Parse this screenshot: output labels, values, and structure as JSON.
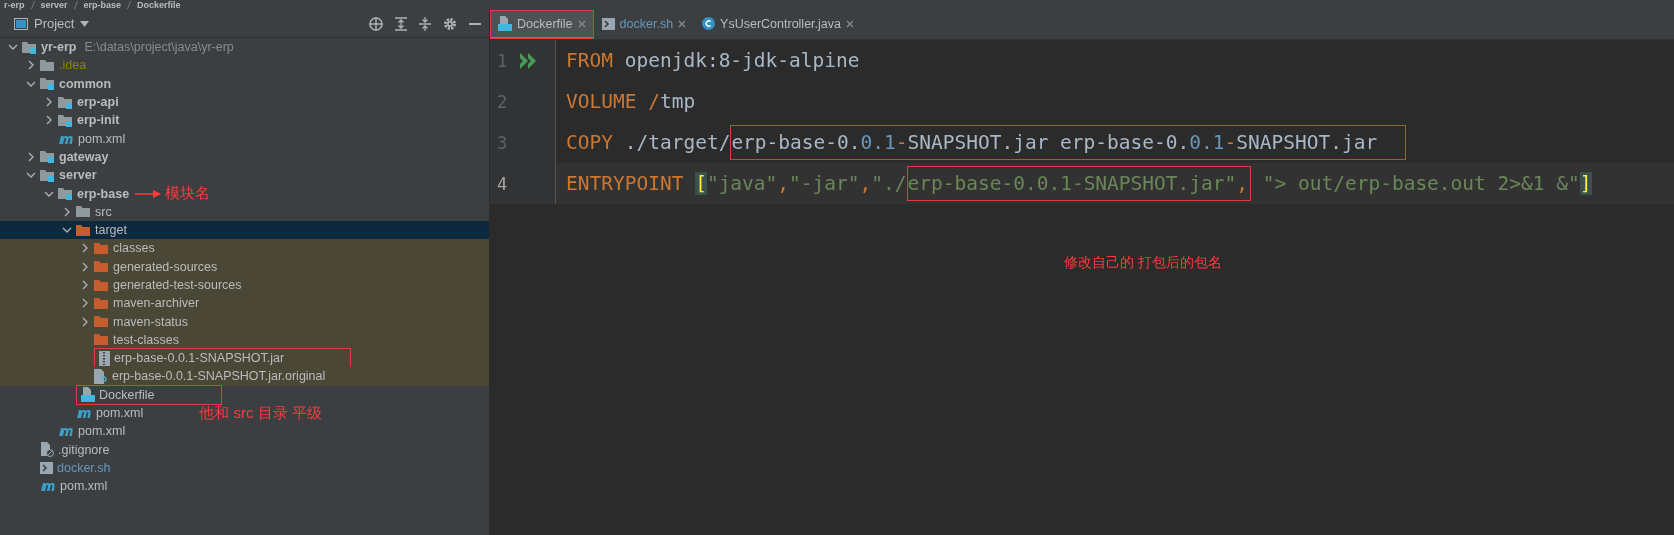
{
  "breadcrumb": [
    "r-erp",
    "server",
    "erp-base",
    "Dockerfile"
  ],
  "project_panel": {
    "title": "Project",
    "tree": [
      {
        "name": "yr-erp",
        "kind": "module",
        "hint": "E:\\datas\\project\\java\\yr-erp",
        "expanded": true,
        "selected": false,
        "children": [
          {
            "name": ".idea",
            "kind": "folder",
            "color": "#848504",
            "expanded": false,
            "selected": false
          },
          {
            "name": "common",
            "kind": "module",
            "expanded": true,
            "selected": false,
            "children": [
              {
                "name": "erp-api",
                "kind": "module",
                "expanded": false,
                "selected": false
              },
              {
                "name": "erp-init",
                "kind": "module",
                "expanded": false,
                "selected": false
              },
              {
                "name": "pom.xml",
                "kind": "maven",
                "selected": false
              }
            ]
          },
          {
            "name": "gateway",
            "kind": "module",
            "expanded": false,
            "selected": false
          },
          {
            "name": "server",
            "kind": "module",
            "expanded": true,
            "selected": false,
            "children": [
              {
                "name": "erp-base",
                "kind": "module",
                "expanded": true,
                "selected": false,
                "note": {
                  "text": "模块名",
                  "arrow": true
                },
                "children": [
                  {
                    "name": "src",
                    "kind": "folder",
                    "expanded": false,
                    "selected": false
                  },
                  {
                    "name": "target",
                    "kind": "excluded-folder",
                    "expanded": true,
                    "selected": true,
                    "children": [
                      {
                        "name": "classes",
                        "kind": "excluded-folder",
                        "expanded": false,
                        "selected": false,
                        "excluded": true
                      },
                      {
                        "name": "generated-sources",
                        "kind": "excluded-folder",
                        "expanded": false,
                        "selected": false,
                        "excluded": true
                      },
                      {
                        "name": "generated-test-sources",
                        "kind": "excluded-folder",
                        "expanded": false,
                        "selected": false,
                        "excluded": true
                      },
                      {
                        "name": "maven-archiver",
                        "kind": "excluded-folder",
                        "expanded": false,
                        "selected": false,
                        "excluded": true
                      },
                      {
                        "name": "maven-status",
                        "kind": "excluded-folder",
                        "expanded": false,
                        "selected": false,
                        "excluded": true
                      },
                      {
                        "name": "test-classes",
                        "kind": "excluded-folder",
                        "selected": false,
                        "excluded": true
                      },
                      {
                        "name": "erp-base-0.0.1-SNAPSHOT.jar",
                        "kind": "jar",
                        "selected": false,
                        "excluded": true,
                        "boxed": true
                      },
                      {
                        "name": "erp-base-0.0.1-SNAPSHOT.jar.original",
                        "kind": "jar-original",
                        "selected": false,
                        "excluded": true
                      }
                    ]
                  },
                  {
                    "name": "Dockerfile",
                    "kind": "dockerfile",
                    "selected": false,
                    "boxed": true
                  },
                  {
                    "name": "pom.xml",
                    "kind": "maven",
                    "selected": false,
                    "note": {
                      "text": "他和 src 目录 平级",
                      "arrow": false
                    }
                  }
                ]
              },
              {
                "name": "pom.xml",
                "kind": "maven",
                "selected": false
              }
            ]
          },
          {
            "name": ".gitignore",
            "kind": "gitignore",
            "selected": false
          },
          {
            "name": "docker.sh",
            "kind": "shell",
            "color": "#6897bb",
            "selected": false
          },
          {
            "name": "pom.xml",
            "kind": "maven",
            "selected": false
          }
        ]
      }
    ]
  },
  "editor": {
    "tabs": [
      {
        "label": "Dockerfile",
        "kind": "dockerfile",
        "selected": true,
        "boxed": true
      },
      {
        "label": "docker.sh",
        "kind": "shell",
        "color": "#6897bb",
        "selected": false
      },
      {
        "label": "YsUserController.java",
        "kind": "class",
        "selected": false
      }
    ],
    "lines": [
      {
        "number": "1",
        "run_marker": true,
        "current": false,
        "tokens": [
          {
            "text": "FROM",
            "color": "#cc7832"
          },
          {
            "text": " openjdk:8-jdk-alpine",
            "color": "#a9b7c6"
          }
        ]
      },
      {
        "number": "2",
        "run_marker": false,
        "current": false,
        "tokens": [
          {
            "text": "VOLUME /",
            "color": "#cc7832"
          },
          {
            "text": "tmp",
            "color": "#a9b7c6"
          }
        ]
      },
      {
        "number": "3",
        "run_marker": false,
        "current": false,
        "tokens": [
          {
            "text": "COPY",
            "color": "#cc7832"
          },
          {
            "text": " ./target/",
            "color": "#a9b7c6"
          },
          {
            "box": [
              {
                "text": "erp-base-0.",
                "color": "#a9b7c6"
              },
              {
                "text": "0.1",
                "color": "#6897bb"
              },
              {
                "text": "-",
                "color": "#cc7832"
              },
              {
                "text": "SNAPSHOT.jar erp-base-0.",
                "color": "#a9b7c6"
              },
              {
                "text": "0.1",
                "color": "#6897bb"
              },
              {
                "text": "-",
                "color": "#cc7832"
              },
              {
                "text": "SNAPSHOT.jar",
                "color": "#a9b7c6"
              }
            ]
          }
        ]
      },
      {
        "number": "4",
        "run_marker": false,
        "current": true,
        "tokens": [
          {
            "text": "ENTRYPOINT ",
            "color": "#cc7832"
          },
          {
            "text": "[",
            "matched": true
          },
          {
            "text": "\"java\"",
            "color": "#6a8759"
          },
          {
            "text": ",",
            "color": "#cc7832"
          },
          {
            "text": "\"-jar\"",
            "color": "#6a8759"
          },
          {
            "text": ",",
            "color": "#cc7832"
          },
          {
            "text": "\"./",
            "color": "#6a8759"
          },
          {
            "box": [
              {
                "text": "erp-base-0.0.1-SNAPSHOT.jar\"",
                "color": "#6a8759"
              },
              {
                "text": ",",
                "color": "#cc7832"
              }
            ]
          },
          {
            "text": " \"> out/erp-base.out 2>&1 &\"",
            "color": "#6a8759"
          },
          {
            "text": "]",
            "matched": true
          }
        ]
      }
    ],
    "annotation": "修改自己的 打包后的包名"
  }
}
